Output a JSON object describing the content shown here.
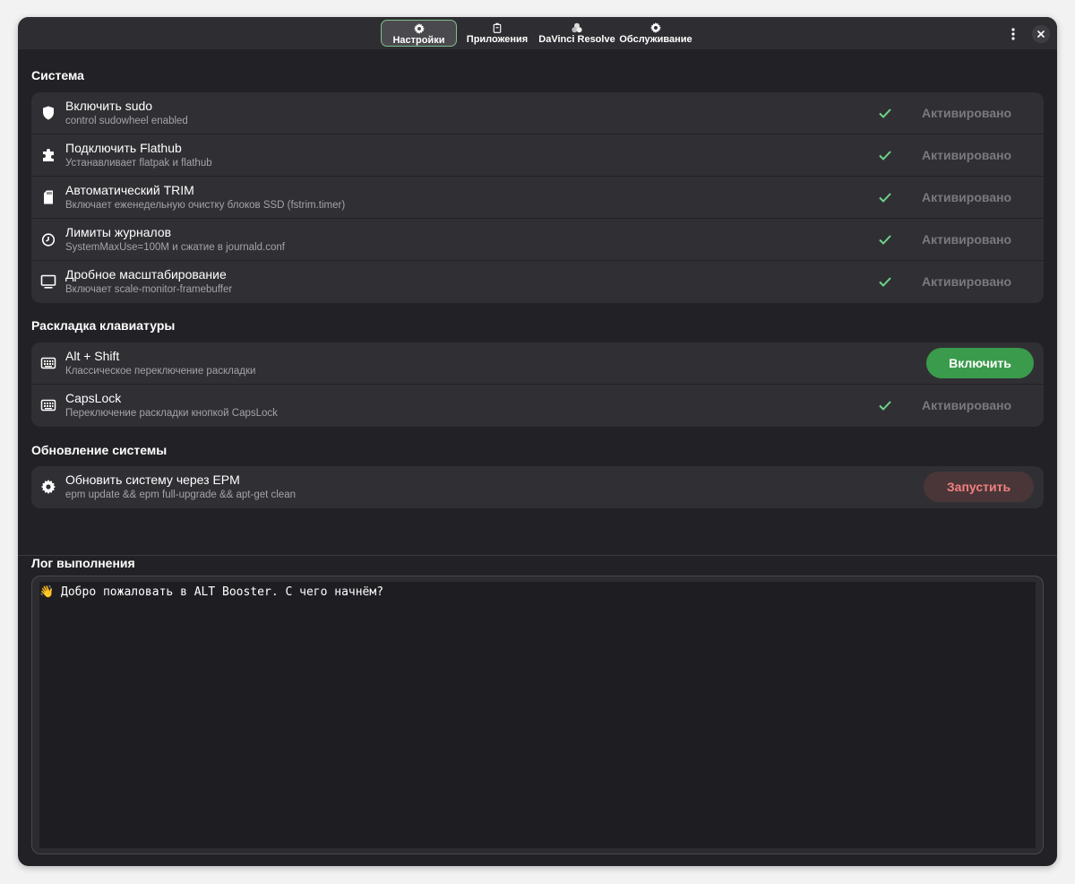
{
  "header": {
    "tabs": [
      {
        "label": "Настройки",
        "icon": "gear-icon",
        "active": true
      },
      {
        "label": "Приложения",
        "icon": "package-icon",
        "active": false
      },
      {
        "label": "DaVinci Resolve",
        "icon": "davinci-icon",
        "active": false
      },
      {
        "label": "Обслуживание",
        "icon": "gear-icon",
        "active": false
      }
    ],
    "menu_icon": "kebab-menu-icon",
    "close_icon": "close-icon"
  },
  "system": {
    "title": "Система",
    "items": [
      {
        "title": "Включить sudo",
        "subtitle": "control sudowheel enabled",
        "icon": "shield-icon",
        "status": "Активировано"
      },
      {
        "title": "Подключить Flathub",
        "subtitle": "Устанавливает flatpak и flathub",
        "icon": "puzzle-icon",
        "status": "Активировано"
      },
      {
        "title": "Автоматический TRIM",
        "subtitle": "Включает еженедельную очистку блоков SSD (fstrim.timer)",
        "icon": "sd-card-icon",
        "status": "Активировано"
      },
      {
        "title": "Лимиты журналов",
        "subtitle": "SystemMaxUse=100M и сжатие в journald.conf",
        "icon": "clock-icon",
        "status": "Активировано"
      },
      {
        "title": "Дробное масштабирование",
        "subtitle": "Включает scale-monitor-framebuffer",
        "icon": "monitor-icon",
        "status": "Активировано"
      }
    ]
  },
  "keyboard": {
    "title": "Раскладка клавиатуры",
    "items": [
      {
        "title": "Alt + Shift",
        "subtitle": "Классическое переключение раскладки",
        "icon": "keyboard-icon",
        "button": "Включить"
      },
      {
        "title": "CapsLock",
        "subtitle": "Переключение раскладки кнопкой CapsLock",
        "icon": "keyboard-icon",
        "status": "Активировано"
      }
    ]
  },
  "update": {
    "title": "Обновление системы",
    "items": [
      {
        "title": "Обновить систему через EPM",
        "subtitle": "epm update && epm full-upgrade && apt-get clean",
        "icon": "cog-badge-icon",
        "button": "Запустить"
      }
    ]
  },
  "log": {
    "title": "Лог выполнения",
    "text": "👋 Добро пожаловать в ALT Booster. С чего начнём?"
  },
  "colors": {
    "accent_green": "#3a9b4c",
    "check_green": "#6fd58a",
    "danger_text": "#f08080",
    "window_bg": "#222226",
    "card_bg": "#303034"
  }
}
